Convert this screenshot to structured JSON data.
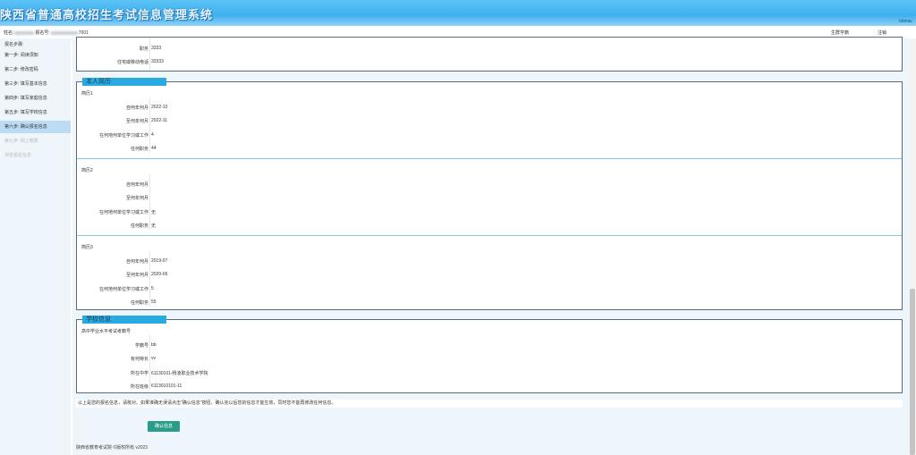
{
  "header": {
    "title": "陕西省普通高校招生考试信息管理系统",
    "code": "kbmac"
  },
  "userbar": {
    "name_label": "姓名:",
    "exam_no_label": "报名号:",
    "exam_no_value": "7001",
    "student_view": "生群学籍",
    "logout": "注销"
  },
  "sidebar": {
    "heading": "报名步骤:",
    "items": [
      {
        "label": "第一步: 阅读须知"
      },
      {
        "label": "第二步: 修改密码"
      },
      {
        "label": "第三步: 填写基本信息"
      },
      {
        "label": "第四步: 填写家庭信息"
      },
      {
        "label": "第五步: 填写学校信息"
      },
      {
        "label": "第六步: 确认报名信息"
      },
      {
        "label": "第七步: 网上缴费"
      },
      {
        "label": "浏览报名信息"
      }
    ]
  },
  "family_tail": {
    "rows": [
      {
        "label": "职务",
        "value": "3333"
      },
      {
        "label": "住宅或移动电话",
        "value": "33333"
      }
    ]
  },
  "resume": {
    "title": "本人简历",
    "entries": [
      {
        "name": "简历1",
        "rows": [
          {
            "label": "自何年何月",
            "value": "2022-10"
          },
          {
            "label": "至何年何月",
            "value": "2022-11"
          },
          {
            "label": "在何地何单位学习或工作",
            "value": "4"
          },
          {
            "label": "任何职务",
            "value": "44"
          }
        ]
      },
      {
        "name": "简历2",
        "rows": [
          {
            "label": "自何年何月",
            "value": ""
          },
          {
            "label": "至何年何月",
            "value": ""
          },
          {
            "label": "在何地何单位学习或工作",
            "value": "无"
          },
          {
            "label": "任何职务",
            "value": "无"
          }
        ]
      },
      {
        "name": "简历3",
        "rows": [
          {
            "label": "自何年何月",
            "value": "2019-07"
          },
          {
            "label": "至何年何月",
            "value": "2020-06"
          },
          {
            "label": "在何地何单位学习或工作",
            "value": "5"
          },
          {
            "label": "任何职务",
            "value": "55"
          }
        ]
      }
    ]
  },
  "school": {
    "title": "学校信息",
    "subtitle": "高中学业水平考试考籍号",
    "rows": [
      {
        "label": "学籍号",
        "value": "bb"
      },
      {
        "label": "有何特长",
        "value": "vv"
      },
      {
        "label": "所在中学",
        "value": "61130101-杨凌职业技术学院"
      },
      {
        "label": "所在班级",
        "value": "6113010101-11"
      }
    ]
  },
  "notice": "以上是您的报名信息，请核对。如果准确无误请点击\"确认信息\"按钮，确认完以后您的信息才能生效，同时您不能再修改任何信息。",
  "confirm_label": "确认信息",
  "footer": "陕西省教育考试院 ©版权所有 v2023"
}
